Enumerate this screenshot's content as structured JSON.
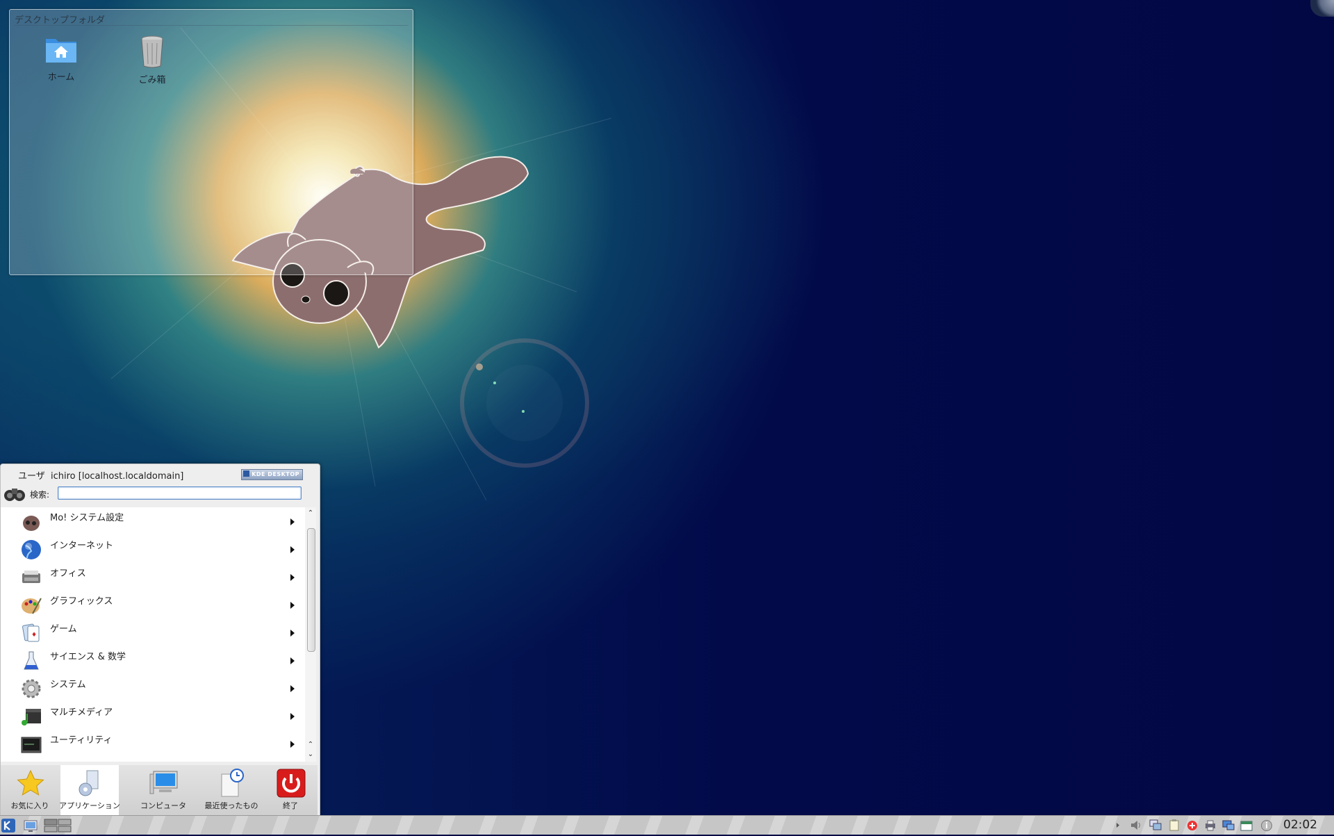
{
  "desktop": {
    "folder_view": {
      "title": "デスクトップフォルダ",
      "icons": [
        {
          "label": "ホーム",
          "icon": "home-folder-icon"
        },
        {
          "label": "ごみ箱",
          "icon": "trash-icon"
        }
      ]
    }
  },
  "kickoff": {
    "user_label": "ユーザ",
    "user_host": "ichiro [localhost.localdomain]",
    "badge": "KDE DESKTOP",
    "search_label": "検索:",
    "search_value": "",
    "categories": [
      {
        "label": "Mo! システム設定",
        "icon": "momonga-icon"
      },
      {
        "label": "インターネット",
        "icon": "globe-icon"
      },
      {
        "label": "オフィス",
        "icon": "typewriter-icon"
      },
      {
        "label": "グラフィックス",
        "icon": "palette-icon"
      },
      {
        "label": "ゲーム",
        "icon": "cards-icon"
      },
      {
        "label": "サイエンス & 数学",
        "icon": "flask-icon"
      },
      {
        "label": "システム",
        "icon": "gear-icon"
      },
      {
        "label": "マルチメディア",
        "icon": "clapperboard-icon"
      },
      {
        "label": "ユーティリティ",
        "icon": "terminal-icon"
      }
    ],
    "tabs": [
      {
        "label": "お気に入り",
        "icon": "star-icon"
      },
      {
        "label": "アプリケーション",
        "icon": "applications-icon"
      },
      {
        "label": "コンピュータ",
        "icon": "computer-icon"
      },
      {
        "label": "最近使ったもの",
        "icon": "recent-icon"
      },
      {
        "label": "終了",
        "icon": "power-icon"
      }
    ],
    "active_tab": "アプリケーション"
  },
  "taskbar": {
    "clock": "02:02",
    "tray_icons": [
      "volume-icon",
      "network-icon",
      "clipboard-icon",
      "update-icon",
      "printer-icon",
      "display-icon",
      "calendar-icon",
      "info-icon"
    ]
  }
}
